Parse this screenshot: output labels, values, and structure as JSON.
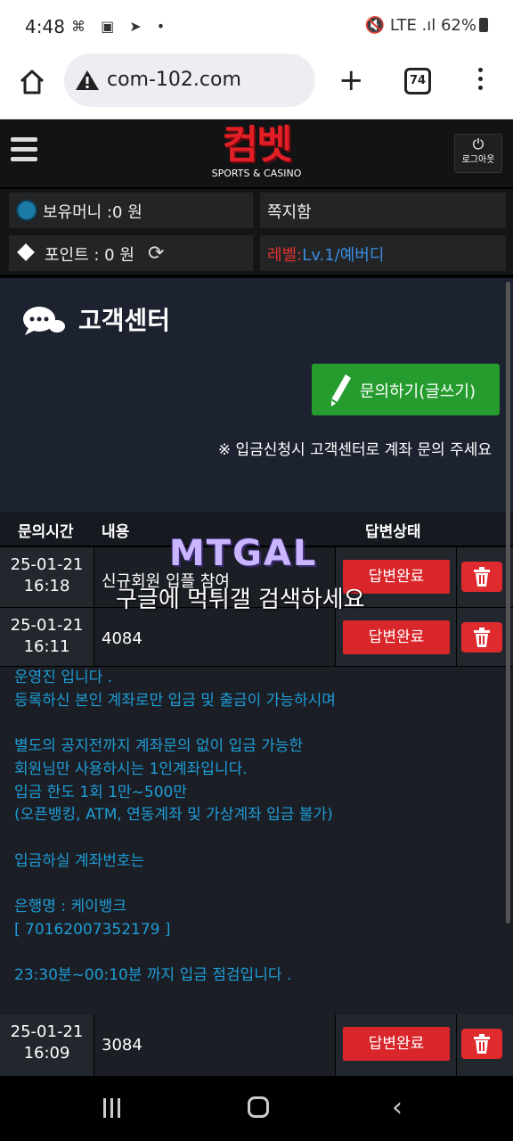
{
  "status_bar": {
    "time": "4:48",
    "left_icons": "⌘ ▣ ➤ •",
    "right_text": "🔇 LTE .ıl 62%"
  },
  "browser": {
    "url": "com-102.com",
    "tab_count": "74"
  },
  "site": {
    "logo_main": "컴벳",
    "logo_sub": "SPORTS & CASINO",
    "logout_label": "로그아웃"
  },
  "info": {
    "money_label": "보유머니 :0 원",
    "message_label": "쪽지함",
    "point_label": "포인트 :  0 원",
    "level_prefix": "레벨:",
    "level_value": "Lv.1/예버디"
  },
  "customer_center": {
    "title": "고객센터",
    "write_button": "문의하기(글쓰기)",
    "notice": "※ 입금신청시 고객센터로 계좌 문의 주세요"
  },
  "table": {
    "headers": {
      "time": "문의시간",
      "content": "내용",
      "status": "답변상태"
    },
    "rows": [
      {
        "date": "25-01-21",
        "time": "16:18",
        "content": "신규회원 입플 참여",
        "status": "답변완료"
      },
      {
        "date": "25-01-21",
        "time": "16:11",
        "content": "4084",
        "status": "답변완료"
      },
      {
        "date": "25-01-21",
        "time": "16:09",
        "content": "3084",
        "status": "답변완료"
      }
    ],
    "answer_lines": [
      "운영진 입니다 .",
      "등록하신 본인 계좌로만 입금 및 출금이 가능하시며",
      "",
      "별도의 공지전까지 계좌문의 없이 입금 가능한",
      "회원님만 사용하시는 1인계좌입니다.",
      "입금 한도 1회 1만~500만",
      "(오픈뱅킹, ATM, 연동계좌 및 가상계좌 입금 불가)",
      "",
      "입금하실 계좌번호는",
      "",
      "은행명 : 케이뱅크",
      "[ 70162007352179 ]",
      "",
      "23:30분~00:10분 까지 입금 점검입니다 ."
    ]
  },
  "watermark": {
    "logo": "MTGAL",
    "text": "구글에 먹튀갤 검색하세요"
  }
}
